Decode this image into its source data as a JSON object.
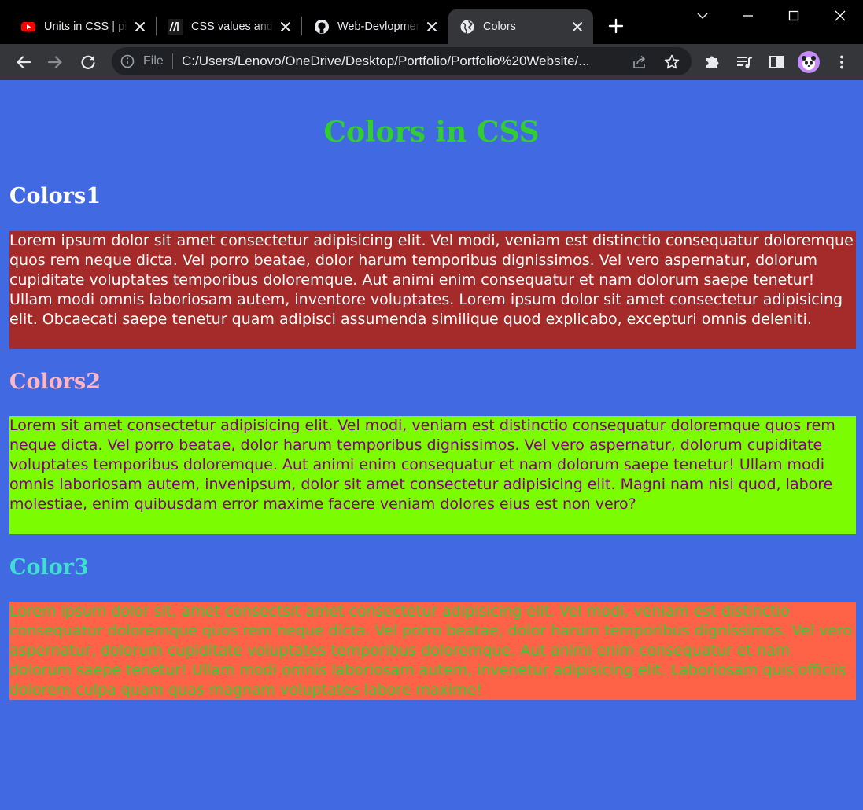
{
  "browser": {
    "tabs": [
      {
        "title": "Units in CSS | pi",
        "favicon": "youtube-icon",
        "active": false
      },
      {
        "title": "CSS values and",
        "favicon": "mdn-icon",
        "active": false
      },
      {
        "title": "Web-Devlopment",
        "favicon": "github-icon",
        "active": false
      },
      {
        "title": "Colors",
        "favicon": "globe-icon",
        "active": true
      }
    ],
    "omnibox": {
      "scheme_label": "File",
      "url": "C:/Users/Lenovo/OneDrive/Desktop/Portfolio/Portfolio%20Website/..."
    }
  },
  "page": {
    "title": "Colors in CSS",
    "title_color": "#32cd32",
    "background": "#4169e1",
    "sections": [
      {
        "heading": "Colors1",
        "heading_color": "#ffffff",
        "text": "Lorem ipsum dolor sit amet consectetur adipisicing elit. Vel modi, veniam est distinctio consequatur doloremque quos rem neque dicta. Vel porro beatae, dolor harum temporibus dignissimos. Vel vero aspernatur, dolorum cupiditate voluptates temporibus doloremque. Aut animi enim consequatur et nam dolorum saepe tenetur! Ullam modi omnis laboriosam autem, inventore voluptates. Lorem ipsum dolor sit amet consectetur adipisicing elit. Obcaecati saepe tenetur quam adipisci assumenda similique quod explicabo, excepturi omnis deleniti.",
        "text_color": "#ffffff",
        "background": "#a52a2a"
      },
      {
        "heading": "Colors2",
        "heading_color": "#ffb6c1",
        "text": "Lorem sit amet consectetur adipisicing elit. Vel modi, veniam est distinctio consequatur doloremque quos rem neque dicta. Vel porro beatae, dolor harum temporibus dignissimos. Vel vero aspernatur, dolorum cupiditate voluptates temporibus doloremque. Aut animi enim consequatur et nam dolorum saepe tenetur! Ullam modi omnis laboriosam autem, invenipsum, dolor sit amet consectetur adipisicing elit. Magni nam nisi quod, labore molestiae, enim quibusdam error maxime facere veniam dolores eius est non vero?",
        "text_color": "#800080",
        "background": "#7cfc00"
      },
      {
        "heading": "Color3",
        "heading_color": "#40e0d0",
        "text": "Lorem ipsum dolor sit, amet consectsit amet consectetur adipisicing elit. Vel modi, veniam est distinctio consequatur doloremque quos rem neque dicta. Vel porro beatae, dolor harum temporibus dignissimos. Vel vero aspernatur, dolorum cupiditate voluptates temporibus doloremque. Aut animi enim consequatur et nam dolorum saepe tenetur! Ullam modi omnis laboriosam autem, invenetur adipisicing elit. Laboriosam quis officiis dolorem culpa quam quas magnam voluptates labore maxime!",
        "text_color": "#32cd32",
        "background": "#ff6347"
      }
    ]
  }
}
